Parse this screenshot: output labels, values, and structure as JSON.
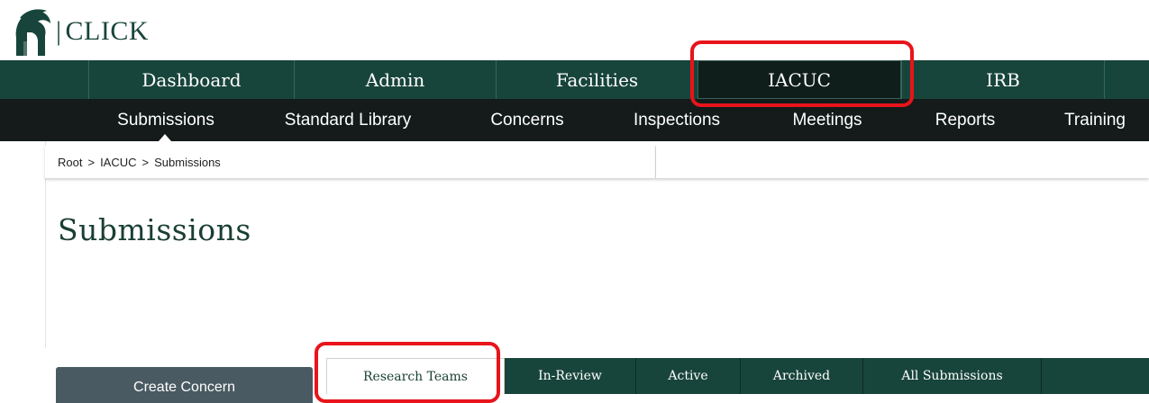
{
  "brand": {
    "name": "CLICK",
    "logo_icon": "spartan-helmet-icon"
  },
  "primary_nav": {
    "tabs": [
      {
        "label": "Dashboard"
      },
      {
        "label": "Admin"
      },
      {
        "label": "Facilities"
      },
      {
        "label": "IACUC",
        "active": true
      },
      {
        "label": "IRB"
      }
    ]
  },
  "secondary_nav": {
    "items": [
      {
        "label": "Submissions",
        "active": true
      },
      {
        "label": "Standard Library"
      },
      {
        "label": "Concerns"
      },
      {
        "label": "Inspections"
      },
      {
        "label": "Meetings"
      },
      {
        "label": "Reports"
      },
      {
        "label": "Training"
      }
    ]
  },
  "breadcrumb": {
    "items": [
      "Root",
      "IACUC",
      "Submissions"
    ],
    "separator": ">"
  },
  "page": {
    "title": "Submissions"
  },
  "actions": {
    "create_concern": "Create Concern"
  },
  "submission_tabs": {
    "items": [
      {
        "label": "Research Teams",
        "selected": true
      },
      {
        "label": "In-Review"
      },
      {
        "label": "Active"
      },
      {
        "label": "Archived"
      },
      {
        "label": "All Submissions"
      }
    ]
  },
  "colors": {
    "brand_green": "#18453b",
    "dark_nav": "#141b1a",
    "active_tab": "#0f1e1b",
    "highlight_red": "#e8141b",
    "button_slate": "#4a5a63"
  }
}
